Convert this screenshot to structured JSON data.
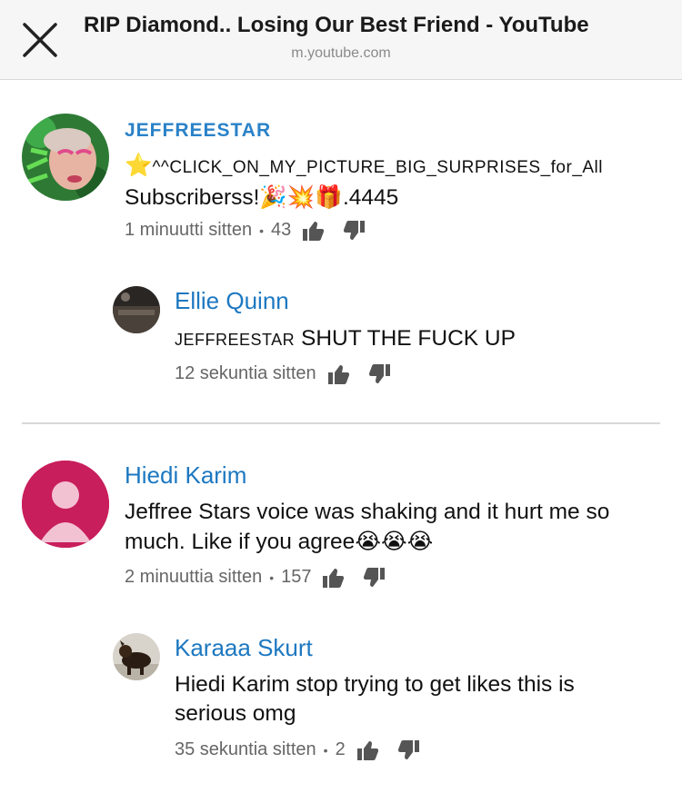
{
  "header": {
    "title": "RIP Diamond.. Losing Our Best Friend - YouTube",
    "url": "m.youtube.com",
    "close_icon": "close-icon"
  },
  "comments": [
    {
      "author": "JEFFREESTAR",
      "text_prefix": "⭐",
      "text_main": "^^CLICK_ON_MY_PICTURE_BIG_SURPRISES_for_All",
      "text_line2": "Subscriberss!",
      "text_emojis": "🎉💥🎁",
      "text_tail": ".4445",
      "time": "1 minuutti sitten",
      "likes": "43"
    },
    {
      "author": "Ellie Quinn",
      "mention": "JEFFREESTAR",
      "text": "SHUT THE FUCK UP",
      "time": "12 sekuntia sitten"
    },
    {
      "author": "Hiedi Karim",
      "text_line1": "Jeffree Stars voice was shaking and it hurt me so",
      "text_line2": "much. Like if you agree",
      "text_emojis": "😭😭😭",
      "time": "2 minuuttia sitten",
      "likes": "157"
    },
    {
      "author": "Karaaa Skurt",
      "text_line1": "Hiedi Karim stop trying to get likes this is",
      "text_line2": "serious omg",
      "time": "35 sekuntia sitten",
      "likes": "2"
    }
  ],
  "colors": {
    "link_blue": "#1d78c1",
    "avatar_pink": "#c81e5b",
    "icon_gray": "#555555"
  }
}
